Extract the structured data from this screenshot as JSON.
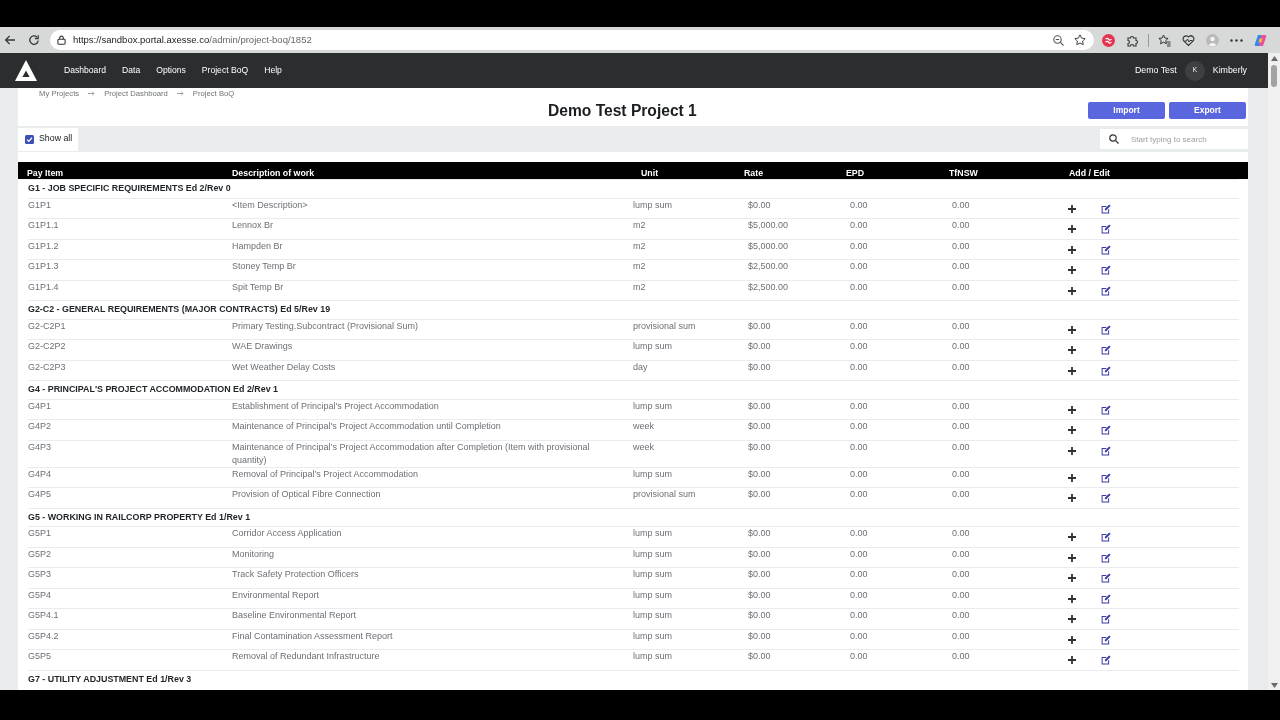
{
  "browser": {
    "url_host": "https://sandbox.portal.axesse.co",
    "url_path": "/admin/project-boq/1852"
  },
  "navbar": {
    "links": [
      "Dashboard",
      "Data",
      "Options",
      "Project BoQ",
      "Help"
    ],
    "account": "Demo Test",
    "user": {
      "initial": "K",
      "name": "Kimberly"
    }
  },
  "breadcrumb": [
    "My Projects",
    "Project Dashboard",
    "Project BoQ"
  ],
  "header": {
    "title": "Demo Test Project 1",
    "buttons": [
      "Import",
      "Export"
    ]
  },
  "filters": {
    "show_all": {
      "label": "Show all",
      "checked": true
    },
    "search": {
      "placeholder": "Start typing to search"
    }
  },
  "table": {
    "columns": [
      "Pay Item",
      "Description of work",
      "Unit",
      "Rate",
      "EPD",
      "TfNSW",
      "Add / Edit"
    ],
    "groups": [
      {
        "title": "G1 - JOB SPECIFIC REQUIREMENTS Ed 2/Rev 0",
        "rows": [
          {
            "code": "G1P1",
            "description": "<Item Description>",
            "unit": "lump sum",
            "rate": "$0.00",
            "epd": "0.00",
            "tfnsw": "0.00"
          },
          {
            "code": "G1P1.1",
            "description": "Lennox Br",
            "unit": "m2",
            "rate": "$5,000.00",
            "epd": "0.00",
            "tfnsw": "0.00"
          },
          {
            "code": "G1P1.2",
            "description": "Hampden Br",
            "unit": "m2",
            "rate": "$5,000.00",
            "epd": "0.00",
            "tfnsw": "0.00"
          },
          {
            "code": "G1P1.3",
            "description": "Stoney Temp Br",
            "unit": "m2",
            "rate": "$2,500.00",
            "epd": "0.00",
            "tfnsw": "0.00"
          },
          {
            "code": "G1P1.4",
            "description": "Spit Temp Br",
            "unit": "m2",
            "rate": "$2,500.00",
            "epd": "0.00",
            "tfnsw": "0.00"
          }
        ]
      },
      {
        "title": "G2-C2 - GENERAL REQUIREMENTS (MAJOR CONTRACTS) Ed 5/Rev 19",
        "rows": [
          {
            "code": "G2-C2P1",
            "description": "Primary Testing.Subcontract (Provisional Sum)",
            "unit": "provisional sum",
            "rate": "$0.00",
            "epd": "0.00",
            "tfnsw": "0.00"
          },
          {
            "code": "G2-C2P2",
            "description": "WAE Drawings",
            "unit": "lump sum",
            "rate": "$0.00",
            "epd": "0.00",
            "tfnsw": "0.00"
          },
          {
            "code": "G2-C2P3",
            "description": "Wet Weather Delay Costs",
            "unit": "day",
            "rate": "$0.00",
            "epd": "0.00",
            "tfnsw": "0.00"
          }
        ]
      },
      {
        "title": "G4 - PRINCIPAL'S PROJECT ACCOMMODATION Ed 2/Rev 1",
        "rows": [
          {
            "code": "G4P1",
            "description": "Establishment of Principal's Project Accommodation",
            "unit": "lump sum",
            "rate": "$0.00",
            "epd": "0.00",
            "tfnsw": "0.00"
          },
          {
            "code": "G4P2",
            "description": "Maintenance of Principal's Project Accommodation until Completion",
            "unit": "week",
            "rate": "$0.00",
            "epd": "0.00",
            "tfnsw": "0.00"
          },
          {
            "code": "G4P3",
            "description": "Maintenance of Principal’s Project Accommodation after Completion (Item with provisional quantity)",
            "unit": "week",
            "rate": "$0.00",
            "epd": "0.00",
            "tfnsw": "0.00"
          },
          {
            "code": "G4P4",
            "description": "Removal of Principal’s Project Accommodation",
            "unit": "lump sum",
            "rate": "$0.00",
            "epd": "0.00",
            "tfnsw": "0.00"
          },
          {
            "code": "G4P5",
            "description": "Provision of Optical Fibre Connection",
            "unit": "provisional sum",
            "rate": "$0.00",
            "epd": "0.00",
            "tfnsw": "0.00"
          }
        ]
      },
      {
        "title": "G5 - WORKING IN RAILCORP PROPERTY Ed 1/Rev 1",
        "rows": [
          {
            "code": "G5P1",
            "description": "Corridor Access Application",
            "unit": "lump sum",
            "rate": "$0.00",
            "epd": "0.00",
            "tfnsw": "0.00"
          },
          {
            "code": "G5P2",
            "description": "Monitoring",
            "unit": "lump sum",
            "rate": "$0.00",
            "epd": "0.00",
            "tfnsw": "0.00"
          },
          {
            "code": "G5P3",
            "description": "Track Safety Protection Officers",
            "unit": "lump sum",
            "rate": "$0.00",
            "epd": "0.00",
            "tfnsw": "0.00"
          },
          {
            "code": "G5P4",
            "description": "Environmental Report",
            "unit": "lump sum",
            "rate": "$0.00",
            "epd": "0.00",
            "tfnsw": "0.00"
          },
          {
            "code": "G5P4.1",
            "description": "Baseline Environmental Report",
            "unit": "lump sum",
            "rate": "$0.00",
            "epd": "0.00",
            "tfnsw": "0.00"
          },
          {
            "code": "G5P4.2",
            "description": "Final Contamination Assessment Report",
            "unit": "lump sum",
            "rate": "$0.00",
            "epd": "0.00",
            "tfnsw": "0.00"
          },
          {
            "code": "G5P5",
            "description": "Removal of Redundant Infrastructure",
            "unit": "lump sum",
            "rate": "$0.00",
            "epd": "0.00",
            "tfnsw": "0.00"
          }
        ]
      },
      {
        "title": "G7 - UTILITY ADJUSTMENT Ed 1/Rev 3"
      }
    ]
  }
}
